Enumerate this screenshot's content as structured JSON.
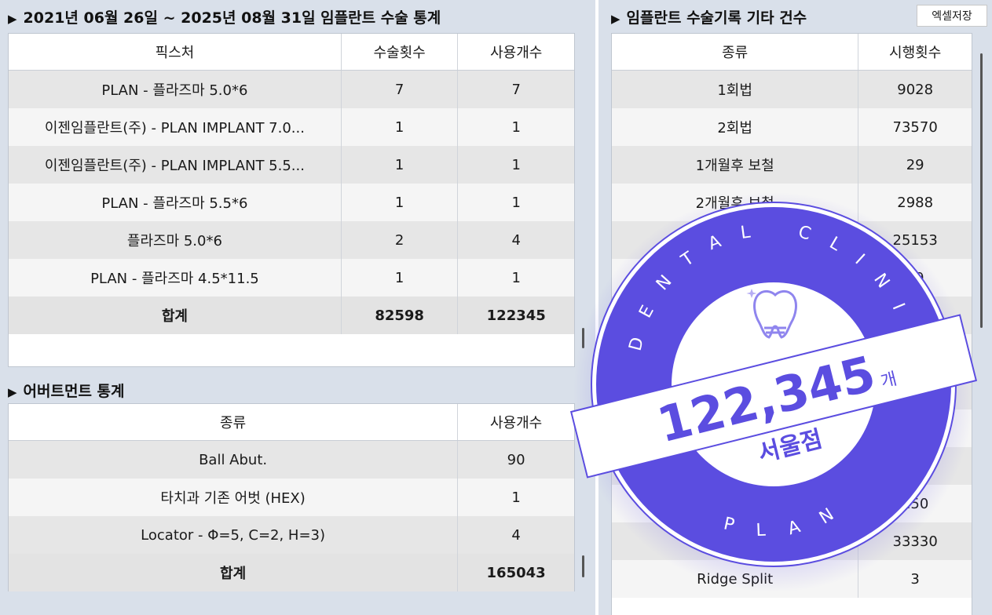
{
  "surgery_stats": {
    "title": "2021년 06월 26일 ~ 2025년 08월 31일 임플란트 수술 통계",
    "columns": [
      "픽스처",
      "수술횟수",
      "사용개수"
    ],
    "rows": [
      [
        "PLAN - 플라즈마 5.0*6",
        "7",
        "7"
      ],
      [
        "이젠임플란트(주) - PLAN IMPLANT 7.0...",
        "1",
        "1"
      ],
      [
        "이젠임플란트(주) - PLAN IMPLANT 5.5...",
        "1",
        "1"
      ],
      [
        "PLAN - 플라즈마 5.5*6",
        "1",
        "1"
      ],
      [
        "플라즈마 5.0*6",
        "2",
        "4"
      ],
      [
        "PLAN - 플라즈마 4.5*11.5",
        "1",
        "1"
      ]
    ],
    "total": [
      "합계",
      "82598",
      "122345"
    ]
  },
  "abutment_stats": {
    "title": "어버트먼트 통계",
    "columns": [
      "종류",
      "사용개수"
    ],
    "rows": [
      [
        "Ball Abut.",
        "90"
      ],
      [
        "타치과 기존 어벗 (HEX)",
        "1"
      ],
      [
        "Locator - Φ=5, C=2, H=3)",
        "4"
      ]
    ],
    "total": [
      "합계",
      "165043"
    ]
  },
  "other_records": {
    "title": "임플란트 수술기록 기타 건수",
    "excel_button": "엑셀저장",
    "columns": [
      "종류",
      "시행횟수"
    ],
    "rows": [
      [
        "1회법",
        "9028"
      ],
      [
        "2회법",
        "73570"
      ],
      [
        "1개월후 보철",
        "29"
      ],
      [
        "2개월후 보철",
        "2988"
      ],
      [
        "",
        "25153"
      ],
      [
        "",
        "89"
      ],
      [
        "",
        ""
      ],
      [
        "",
        ""
      ],
      [
        "",
        ""
      ],
      [
        "",
        ""
      ],
      [
        "",
        ""
      ],
      [
        "",
        "250"
      ],
      [
        "",
        "33330"
      ],
      [
        "Ridge Split",
        "3"
      ]
    ]
  },
  "badge": {
    "arc_top": "DENTAL CLINIC",
    "arc_bottom": "PLAN",
    "count": "122,345",
    "unit": "개",
    "branch": "서울점",
    "color": "#5b4de0"
  }
}
